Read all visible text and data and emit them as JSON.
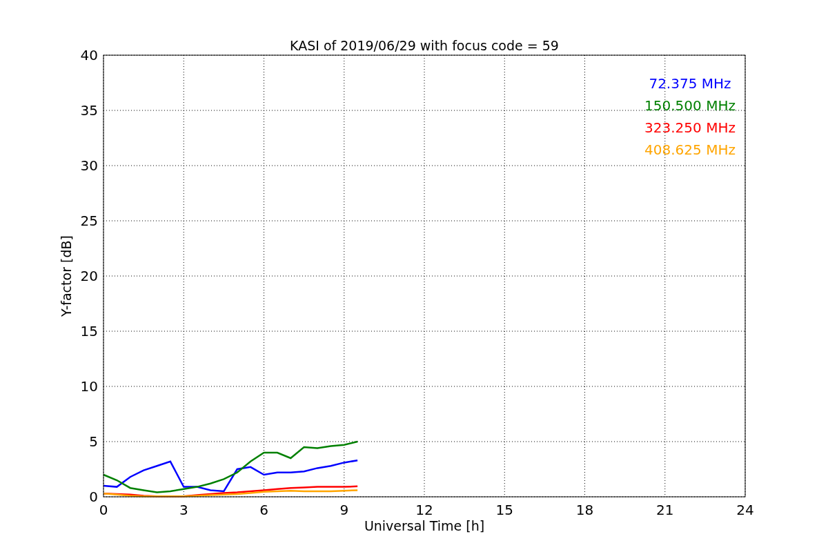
{
  "chart_data": {
    "type": "line",
    "title": "KASI of 2019/06/29 with focus code = 59",
    "xlabel": "Universal Time [h]",
    "ylabel": "Y-factor [dB]",
    "x": [
      0,
      0.5,
      1,
      1.5,
      2,
      2.5,
      3,
      3.5,
      4,
      4.5,
      5,
      5.5,
      6,
      6.5,
      7,
      7.5,
      8,
      8.5,
      9,
      9.5
    ],
    "series": [
      {
        "name": "72.375 MHz",
        "color": "#0000ff",
        "values": [
          1.0,
          0.9,
          1.8,
          2.4,
          2.8,
          3.2,
          0.9,
          0.9,
          0.6,
          0.5,
          2.5,
          2.7,
          2.0,
          2.2,
          2.2,
          2.3,
          2.6,
          2.8,
          3.1,
          3.3
        ]
      },
      {
        "name": "150.500 MHz",
        "color": "#008000",
        "values": [
          2.0,
          1.5,
          0.8,
          0.6,
          0.4,
          0.5,
          0.7,
          0.9,
          1.2,
          1.6,
          2.2,
          3.2,
          4.0,
          4.0,
          3.5,
          4.5,
          4.4,
          4.6,
          4.7,
          5.0
        ]
      },
      {
        "name": "323.250 MHz",
        "color": "#ff0000",
        "values": [
          0.3,
          0.25,
          0.2,
          0.1,
          0.05,
          0.05,
          0.05,
          0.15,
          0.25,
          0.35,
          0.4,
          0.5,
          0.6,
          0.7,
          0.8,
          0.85,
          0.9,
          0.9,
          0.9,
          0.95
        ]
      },
      {
        "name": "408.625 MHz",
        "color": "#ffa500",
        "values": [
          0.3,
          0.2,
          0.1,
          0.05,
          0.05,
          0.05,
          0.05,
          0.1,
          0.15,
          0.2,
          0.25,
          0.35,
          0.45,
          0.5,
          0.55,
          0.5,
          0.5,
          0.5,
          0.55,
          0.6
        ]
      }
    ],
    "grid": true,
    "xlim": [
      0,
      24
    ],
    "ylim": [
      0,
      40
    ],
    "xticks": [
      0,
      3,
      6,
      9,
      12,
      15,
      18,
      21,
      24
    ],
    "yticks": [
      0,
      5,
      10,
      15,
      20,
      25,
      30,
      35,
      40
    ]
  }
}
